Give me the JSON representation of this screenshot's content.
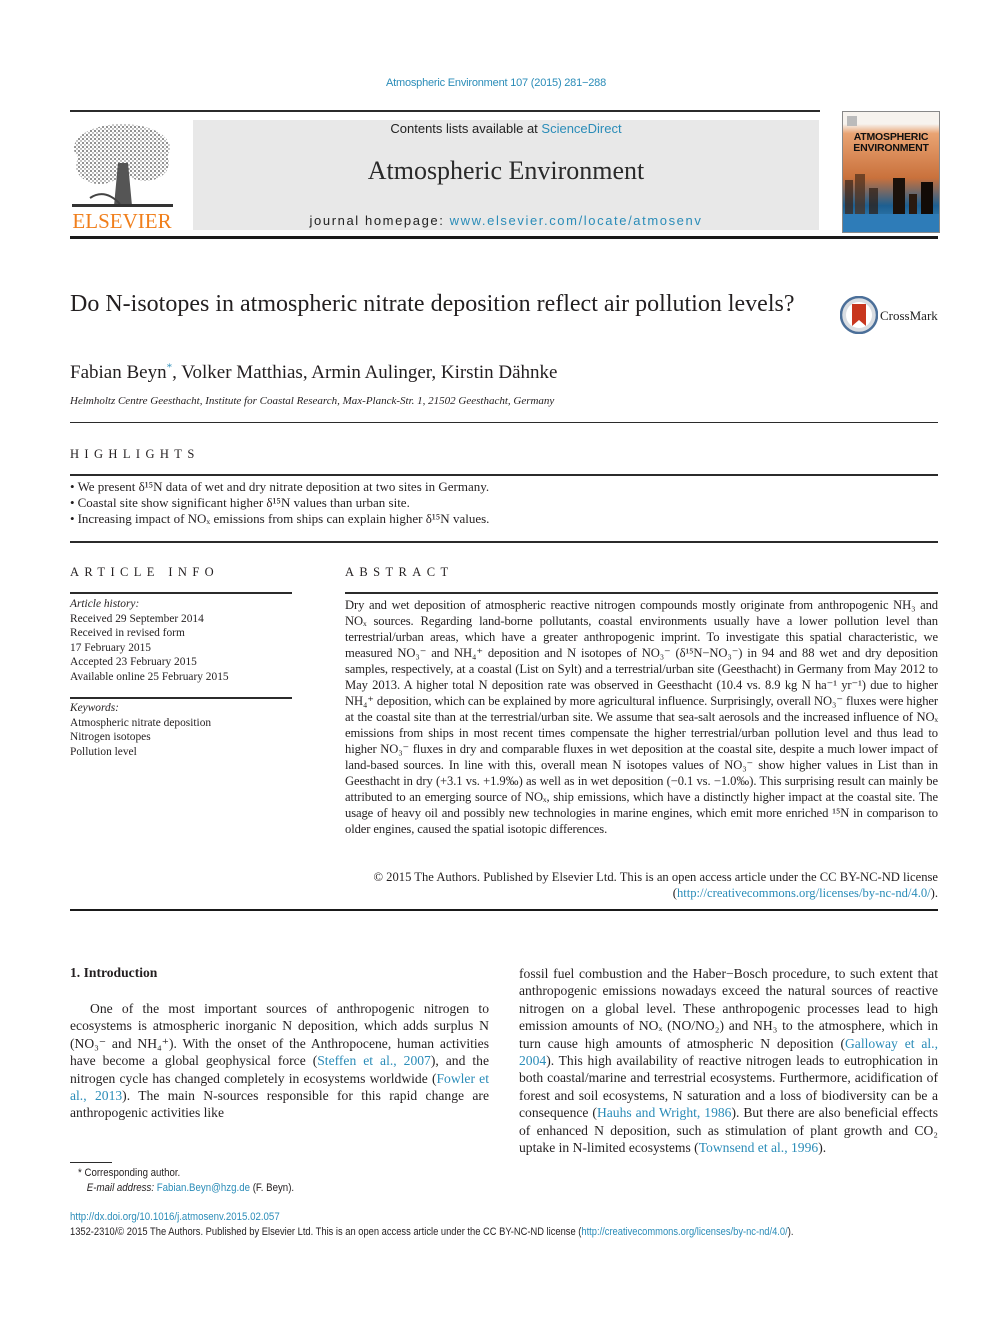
{
  "header": {
    "citation": "Atmospheric Environment 107 (2015) 281−288",
    "contents_prefix": "Contents lists available at ",
    "contents_link": "ScienceDirect",
    "journal_title": "Atmospheric Environment",
    "homepage_prefix": "journal homepage: ",
    "homepage_link": "www.elsevier.com/locate/atmosenv",
    "publisher_logo_text": "ELSEVIER",
    "cover_title_line1": "ATMOSPHERIC",
    "cover_title_line2": "ENVIRONMENT",
    "brand_orange": "#f07f1c",
    "link_color": "#2a8cb8"
  },
  "article": {
    "title": "Do N-isotopes in atmospheric nitrate deposition reflect air pollution levels?",
    "crossmark_label": "CrossMark",
    "authors": [
      {
        "name": "Fabian Beyn",
        "mark": "*"
      },
      {
        "name": "Volker Matthias"
      },
      {
        "name": "Armin Aulinger"
      },
      {
        "name": "Kirstin Dähnke"
      }
    ],
    "affiliation": "Helmholtz Centre Geesthacht, Institute for Coastal Research, Max-Planck-Str. 1, 21502 Geesthacht, Germany"
  },
  "highlights": {
    "heading": "HIGHLIGHTS",
    "items": [
      "We present δ¹⁵N data of wet and dry nitrate deposition at two sites in Germany.",
      "Coastal site show significant higher δ¹⁵N values than urban site.",
      "Increasing impact of NOₓ emissions from ships can explain higher δ¹⁵N values."
    ]
  },
  "article_info": {
    "heading": "ARTICLE INFO",
    "history_label": "Article history:",
    "history": [
      "Received 29 September 2014",
      "Received in revised form",
      "17 February 2015",
      "Accepted 23 February 2015",
      "Available online 25 February 2015"
    ],
    "keywords_label": "Keywords:",
    "keywords": [
      "Atmospheric nitrate deposition",
      "Nitrogen isotopes",
      "Pollution level"
    ]
  },
  "abstract": {
    "heading": "ABSTRACT",
    "text": "Dry and wet deposition of atmospheric reactive nitrogen compounds mostly originate from anthropogenic NH₃ and NOₓ sources. Regarding land-borne pollutants, coastal environments usually have a lower pollution level than terrestrial/urban areas, which have a greater anthropogenic imprint. To investigate this spatial characteristic, we measured NO₃⁻ and NH₄⁺ deposition and N isotopes of NO₃⁻ (δ¹⁵N−NO₃⁻) in 94 and 88 wet and dry deposition samples, respectively, at a coastal (List on Sylt) and a terrestrial/urban site (Geesthacht) in Germany from May 2012 to May 2013. A higher total N deposition rate was observed in Geesthacht (10.4 vs. 8.9 kg N ha⁻¹ yr⁻¹) due to higher NH₄⁺ deposition, which can be explained by more agricultural influence. Surprisingly, overall NO₃⁻ fluxes were higher at the coastal site than at the terrestrial/urban site. We assume that sea-salt aerosols and the increased influence of NOₓ emissions from ships in most recent times compensate the higher terrestrial/urban pollution level and thus lead to higher NO₃⁻ fluxes in dry and comparable fluxes in wet deposition at the coastal site, despite a much lower impact of land-based sources. In line with this, overall mean N isotopes values of NO₃⁻ show higher values in List than in Geesthacht in dry (+3.1 vs. +1.9‰) as well as in wet deposition (−0.1 vs. −1.0‰). This surprising result can mainly be attributed to an emerging source of NOₓ, ship emissions, which have a distinctly higher impact at the coastal site. The usage of heavy oil and possibly new technologies in marine engines, which emit more enriched ¹⁵N in comparison to older engines, caused the spatial isotopic differences.",
    "copyright_prefix": "© 2015 The Authors. Published by Elsevier Ltd. This is an open access article under the CC BY-NC-ND license (",
    "license_link": "http://creativecommons.org/licenses/by-nc-nd/4.0/",
    "copyright_suffix": ")."
  },
  "body": {
    "section_heading": "1.  Introduction",
    "left_column": [
      {
        "t": "One of the most important sources of anthropogenic nitrogen to ecosystems is atmospheric inorganic N deposition, which adds surplus N (NO₃⁻ and NH₄⁺). With the onset of the Anthropocene, human activities have become a global geophysical force ("
      },
      {
        "link": "Steffen et al., 2007"
      },
      {
        "t": "), and the nitrogen cycle has changed completely in ecosystems worldwide ("
      },
      {
        "link": "Fowler et al., 2013"
      },
      {
        "t": "). The main N-sources responsible for this rapid change are anthropogenic activities like"
      }
    ],
    "right_column": [
      {
        "t": "fossil fuel combustion and the Haber−Bosch procedure, to such extent that anthropogenic emissions nowadays exceed the natural sources of reactive nitrogen on a global level. These anthropogenic processes lead to high emission amounts of NOₓ (NO/NO₂) and NH₃ to the atmosphere, which in turn cause high amounts of atmospheric N deposition ("
      },
      {
        "link": "Galloway et al., 2004"
      },
      {
        "t": "). This high availability of reactive nitrogen leads to eutrophication in both coastal/marine and terrestrial ecosystems. Furthermore, acidification of forest and soil ecosystems, N saturation and a loss of biodiversity can be a consequence ("
      },
      {
        "link": "Hauhs and Wright, 1986"
      },
      {
        "t": "). But there are also beneficial effects of enhanced N deposition, such as stimulation of plant growth and CO₂ uptake in N-limited ecosystems ("
      },
      {
        "link": "Townsend et al., 1996"
      },
      {
        "t": ")."
      }
    ]
  },
  "footnote": {
    "mark": "*",
    "corresponding": "Corresponding author.",
    "email_label": "E-mail address:",
    "email": "Fabian.Beyn@hzg.de",
    "email_suffix": " (F. Beyn)."
  },
  "footer": {
    "doi": "http://dx.doi.org/10.1016/j.atmosenv.2015.02.057",
    "issn_prefix": "1352-2310/© 2015 The Authors. Published by Elsevier Ltd. This is an open access article under the CC BY-NC-ND license (",
    "license_link": "http://creativecommons.org/licenses/by-nc-nd/4.0/",
    "issn_suffix": ")."
  }
}
